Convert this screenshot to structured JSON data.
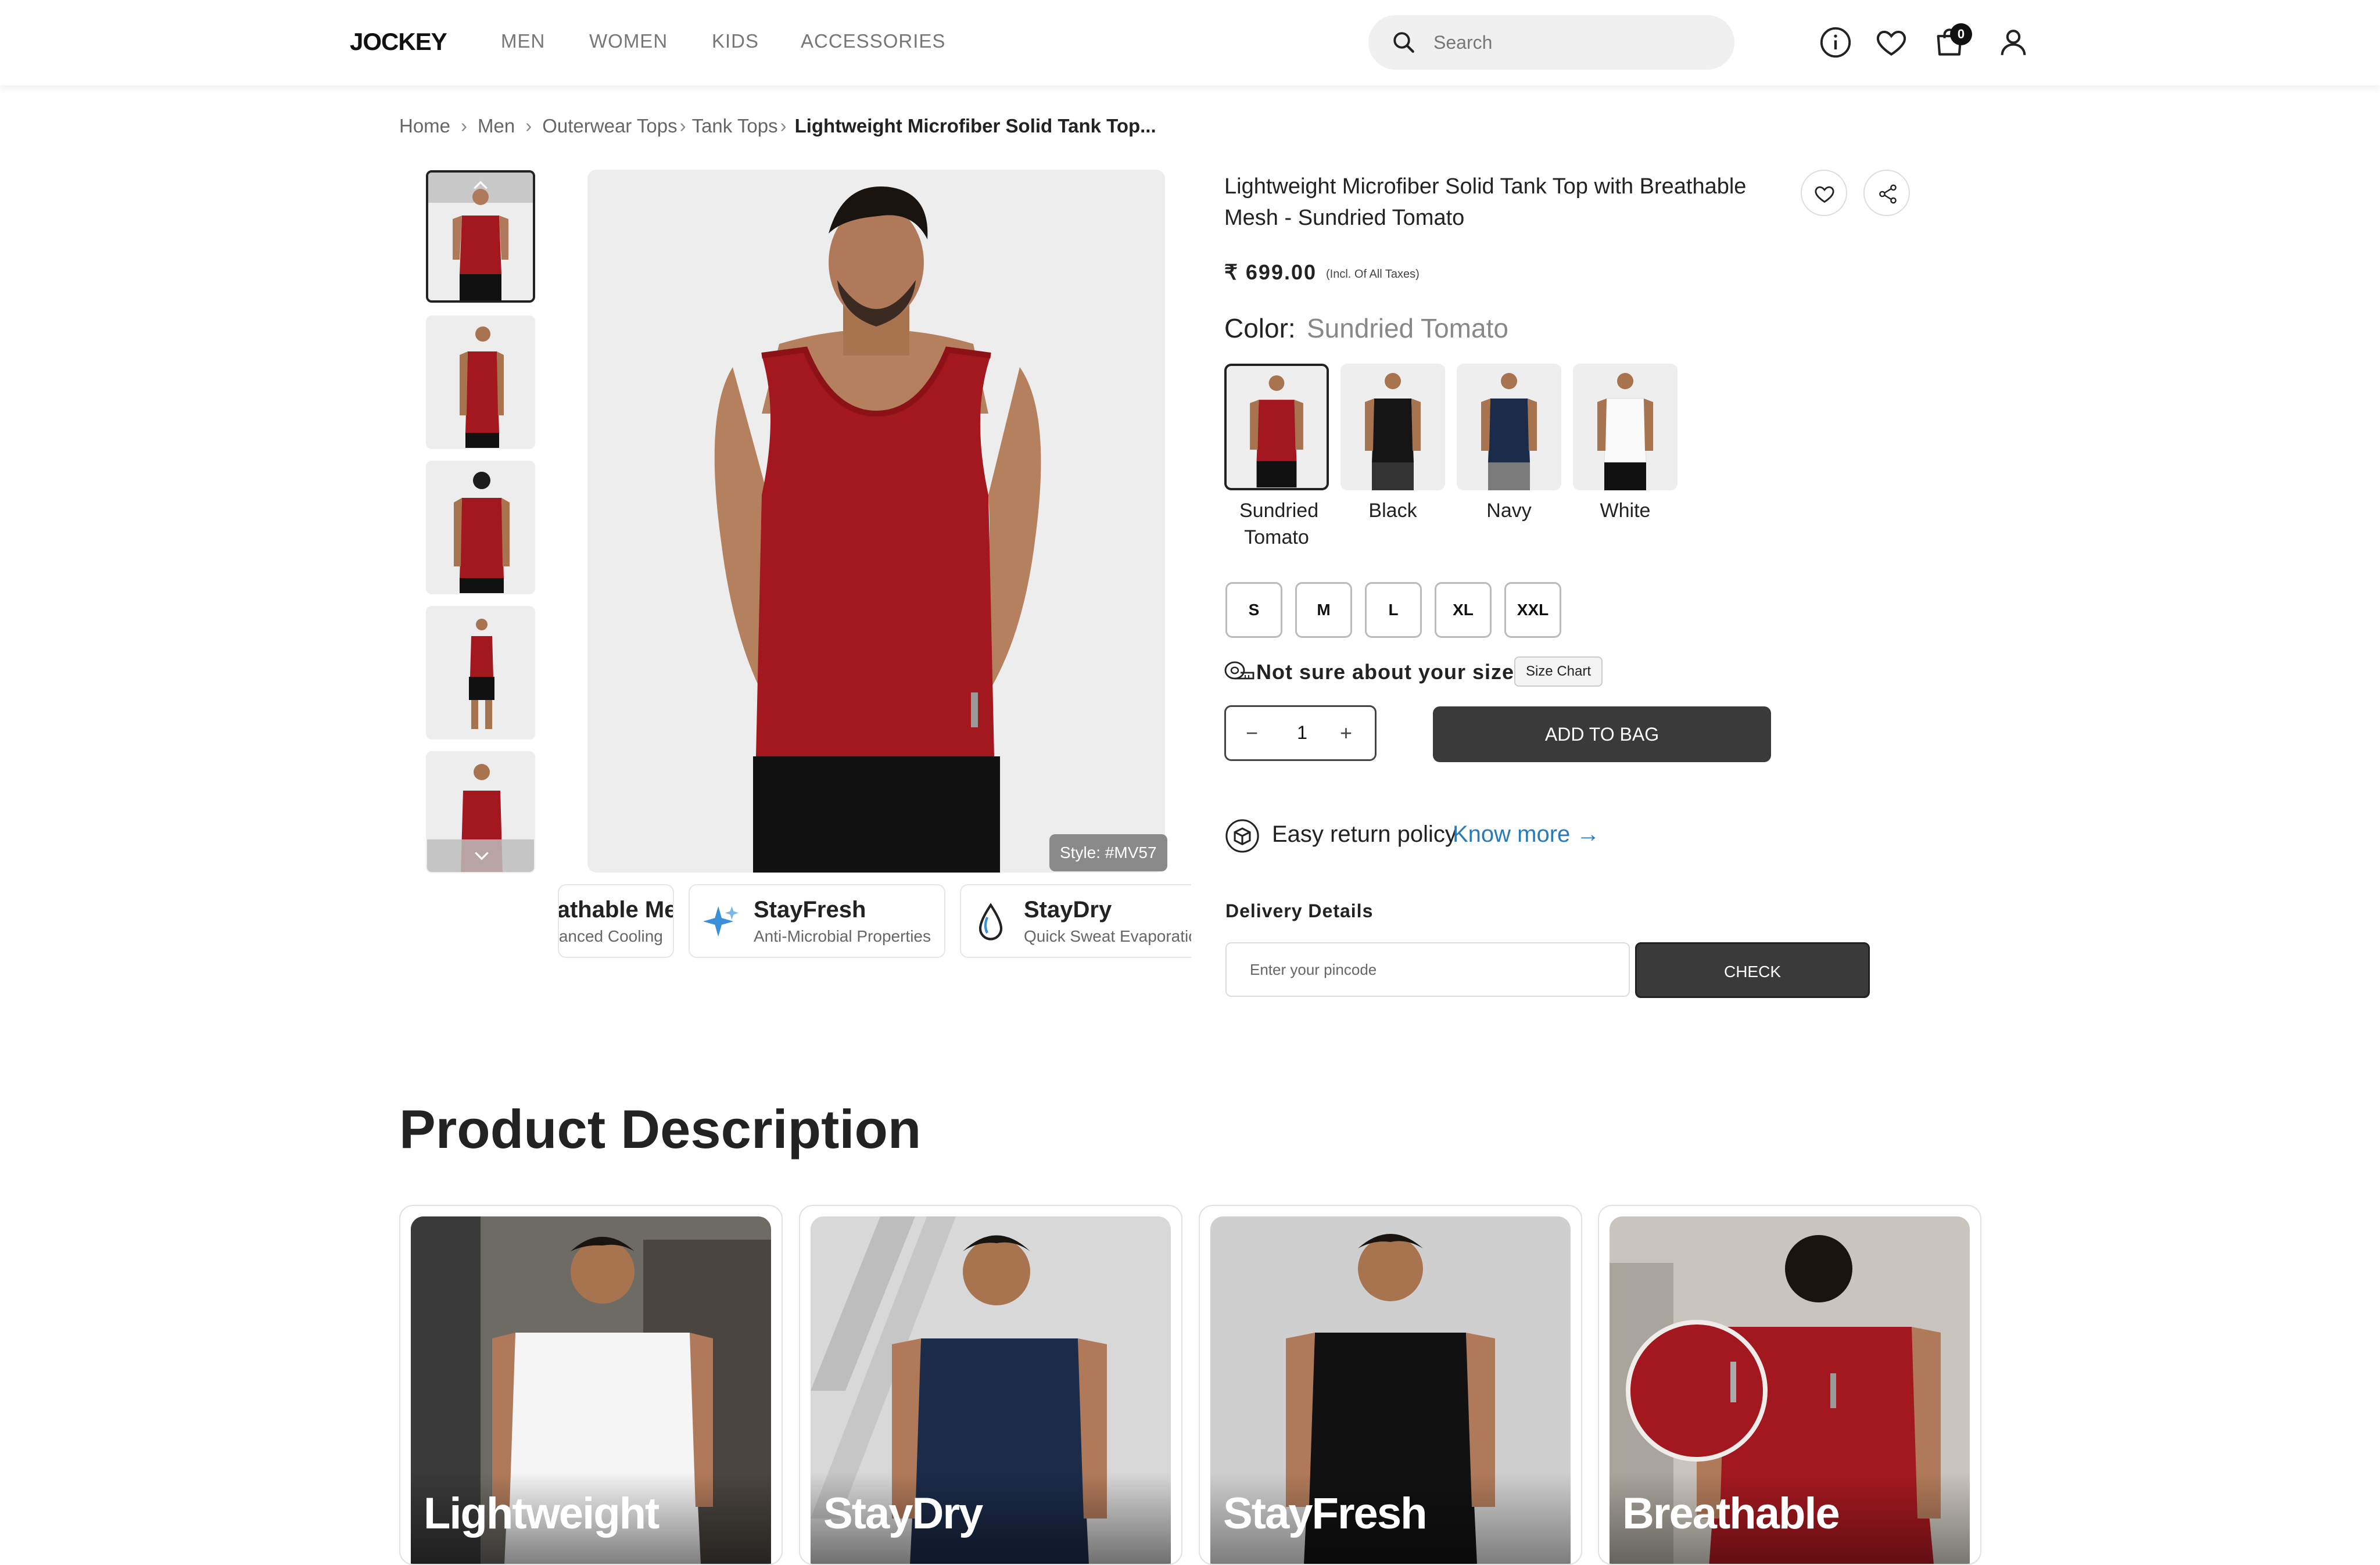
{
  "brand": "JOCKEY",
  "nav": [
    "MEN",
    "WOMEN",
    "KIDS",
    "ACCESSORIES"
  ],
  "search": {
    "placeholder": "Search"
  },
  "header_icons": [
    "info-icon",
    "heart-icon",
    "bag-icon",
    "user-icon"
  ],
  "cart": {
    "count": "0"
  },
  "breadcrumb": [
    "Home",
    "Men",
    "Outerwear Tops",
    "Tank Tops",
    "Lightweight Microfiber Solid Tank Top..."
  ],
  "gallery": {
    "thumbnails": [
      "front",
      "side",
      "back",
      "full",
      "front-2"
    ],
    "style_code": "Style: #MV57"
  },
  "features": [
    {
      "title": "Breathable Mesh",
      "subtitle": "Enhanced Cooling",
      "icon": "mesh-icon"
    },
    {
      "title": "StayFresh",
      "subtitle": "Anti-Microbial Properties",
      "icon": "sparkle-icon"
    },
    {
      "title": "StayDry",
      "subtitle": "Quick Sweat Evaporation",
      "icon": "drop-icon"
    }
  ],
  "product": {
    "title": "Lightweight Microfiber Solid Tank Top with Breathable Mesh - Sundried Tomato",
    "price": "₹ 699.00",
    "price_note": "(Incl. Of All Taxes)",
    "color_label": "Color:",
    "color_value": "Sundried Tomato",
    "colors": [
      {
        "name": "Sundried Tomato",
        "hex": "#a3181f"
      },
      {
        "name": "Black",
        "hex": "#151515"
      },
      {
        "name": "Navy",
        "hex": "#1b2b4a"
      },
      {
        "name": "White",
        "hex": "#f4f4f4"
      }
    ],
    "sizes": [
      "S",
      "M",
      "L",
      "XL",
      "XXL"
    ],
    "size_question": "Not sure about your size?",
    "size_chart": "Size Chart",
    "quantity": "1",
    "add_to_bag": "ADD TO BAG",
    "return_text": "Easy return policy",
    "know_more": "Know more →",
    "delivery_label": "Delivery Details",
    "pincode_placeholder": "Enter your pincode",
    "check": "CHECK"
  },
  "description": {
    "title": "Product Description",
    "cards": [
      "Lightweight",
      "StayDry",
      "StayFresh",
      "Breathable"
    ]
  },
  "colors": {
    "accent": "#2a7bb5",
    "button": "#3a3a3a",
    "product_red": "#a3181f"
  }
}
